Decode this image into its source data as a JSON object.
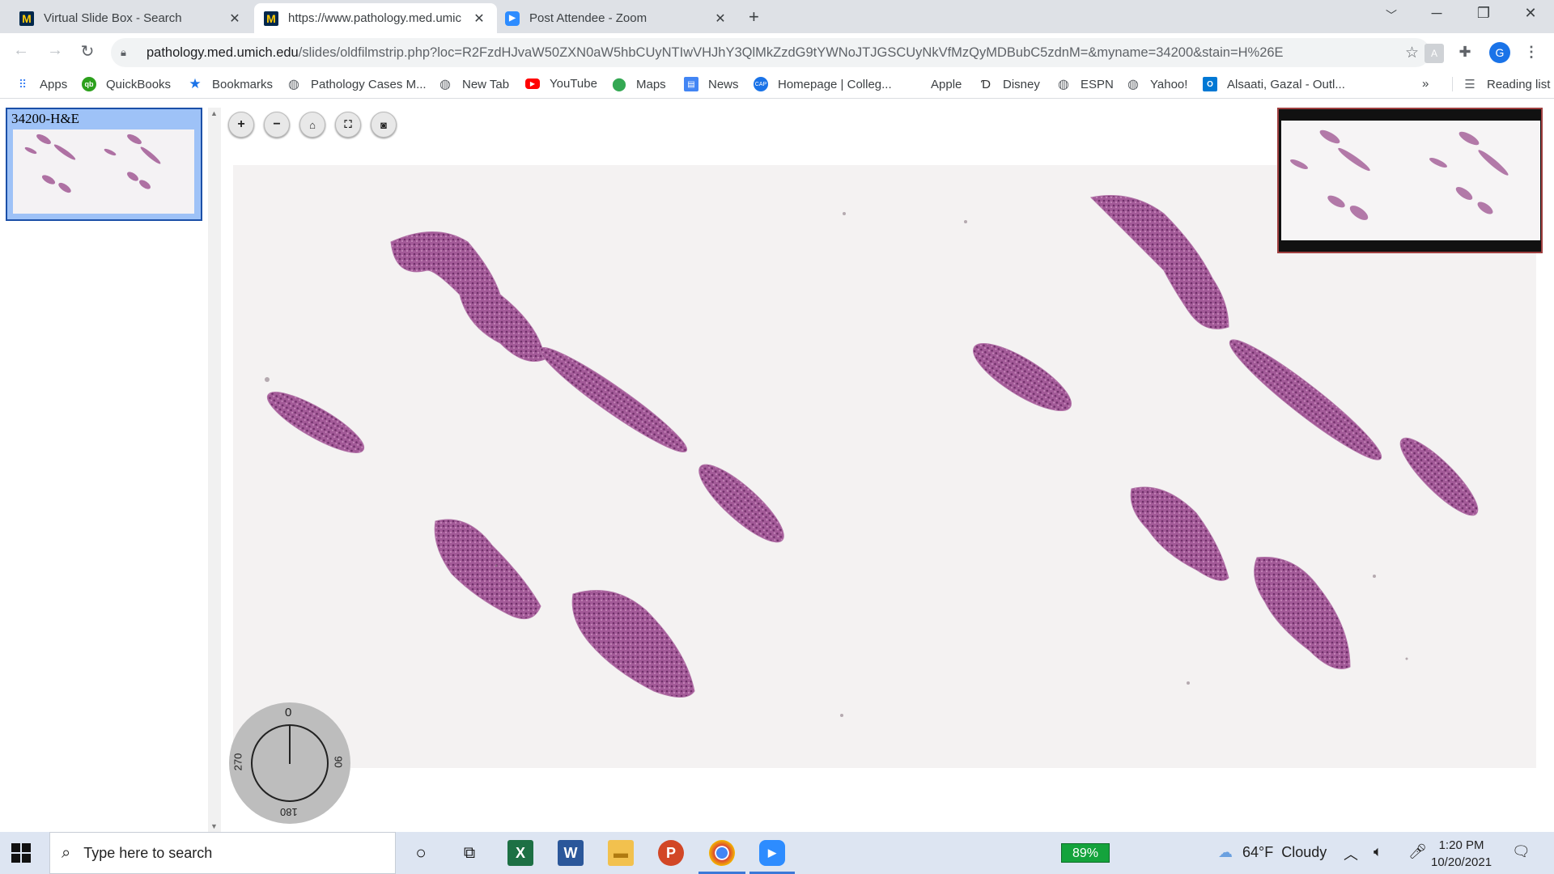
{
  "browser": {
    "tabs": [
      {
        "title": "Virtual Slide Box - Search",
        "icon": "umich-m-icon"
      },
      {
        "title": "https://www.pathology.med.umic",
        "icon": "umich-m-icon"
      },
      {
        "title": "Post Attendee - Zoom",
        "icon": "zoom-icon"
      }
    ],
    "url_host": "pathology.med.umich.edu",
    "url_path": "/slides/oldfilmstrip.php?loc=R2FzdHJvaW50ZXN0aW5hbCUyNTIwVHJhY3QlMkZzdG9tYWNoJTJGSCUyNkVfMzQyMDBubC5zdnM=&myname=34200&stain=H%26E",
    "profile_initial": "G",
    "bookmarks": [
      {
        "label": "Apps",
        "icon": "apps-grid-icon"
      },
      {
        "label": "QuickBooks",
        "icon": "quickbooks-icon"
      },
      {
        "label": "Bookmarks",
        "icon": "star-icon"
      },
      {
        "label": "Pathology Cases M...",
        "icon": "globe-icon"
      },
      {
        "label": "New Tab",
        "icon": "globe-icon"
      },
      {
        "label": "YouTube",
        "icon": "youtube-icon"
      },
      {
        "label": "Maps",
        "icon": "maps-pin-icon"
      },
      {
        "label": "News",
        "icon": "news-icon"
      },
      {
        "label": "Homepage | Colleg...",
        "icon": "cap-icon"
      },
      {
        "label": "Apple",
        "icon": "apple-icon"
      },
      {
        "label": "Disney",
        "icon": "disney-icon"
      },
      {
        "label": "ESPN",
        "icon": "globe-icon"
      },
      {
        "label": "Yahoo!",
        "icon": "globe-icon"
      },
      {
        "label": "Alsaati, Gazal - Outl...",
        "icon": "outlook-icon"
      }
    ],
    "overflow_label": "»",
    "reading_list_label": "Reading list"
  },
  "viewer": {
    "filmstrip_label": "34200-H&E",
    "rotation_labels": {
      "top": "0",
      "right": "90",
      "bottom": "180",
      "left": "270"
    }
  },
  "taskbar": {
    "search_placeholder": "Type here to search",
    "battery": "89%",
    "temperature": "64°F",
    "weather": "Cloudy",
    "time": "1:20 PM",
    "date": "10/20/2021"
  },
  "colors": {
    "tissue_dark": "#9b4f8f",
    "tissue_light": "#c48ab9",
    "accent_blue": "#1a73e8"
  }
}
